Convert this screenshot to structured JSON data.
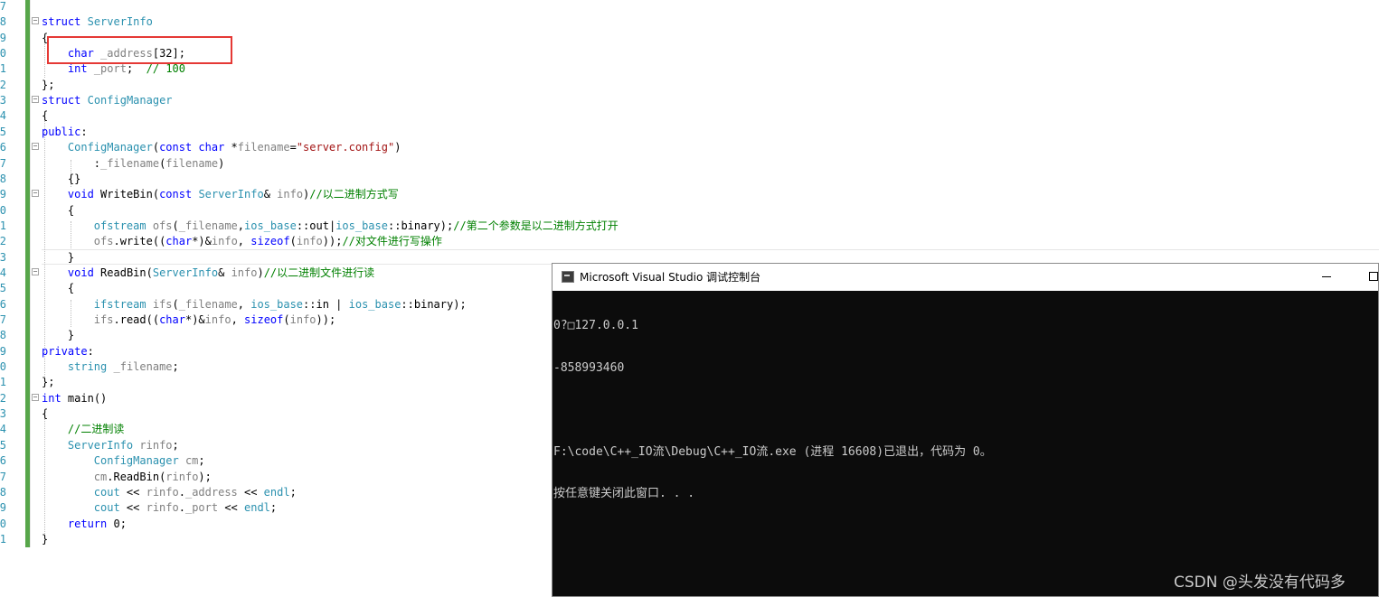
{
  "editor": {
    "lines": [
      {
        "no": "7",
        "text": ""
      },
      {
        "no": "8",
        "text": "struct ServerInfo"
      },
      {
        "no": "9",
        "text": "{"
      },
      {
        "no": "0",
        "text": "    char _address[32];"
      },
      {
        "no": "1",
        "text": "    int _port;  // 100"
      },
      {
        "no": "2",
        "text": "};"
      },
      {
        "no": "3",
        "text": "struct ConfigManager"
      },
      {
        "no": "4",
        "text": "{"
      },
      {
        "no": "5",
        "text": "public:"
      },
      {
        "no": "6",
        "text": "    ConfigManager(const char *filename=\"server.config\")"
      },
      {
        "no": "7",
        "text": "        :_filename(filename)"
      },
      {
        "no": "8",
        "text": "    {}"
      },
      {
        "no": "9",
        "text": "    void WriteBin(const ServerInfo& info)//以二进制方式写"
      },
      {
        "no": "0",
        "text": "    {"
      },
      {
        "no": "1",
        "text": "        ofstream ofs(_filename,ios_base::out|ios_base::binary);//第二个参数是以二进制方式打开"
      },
      {
        "no": "2",
        "text": "        ofs.write((char*)&info, sizeof(info));//对文件进行写操作"
      },
      {
        "no": "3",
        "text": "    }"
      },
      {
        "no": "4",
        "text": "    void ReadBin(ServerInfo& info)//以二进制文件进行读"
      },
      {
        "no": "5",
        "text": "    {"
      },
      {
        "no": "6",
        "text": "        ifstream ifs(_filename, ios_base::in | ios_base::binary);"
      },
      {
        "no": "7",
        "text": "        ifs.read((char*)&info, sizeof(info));"
      },
      {
        "no": "8",
        "text": "    }"
      },
      {
        "no": "9",
        "text": "private:"
      },
      {
        "no": "0",
        "text": "    string _filename;"
      },
      {
        "no": "1",
        "text": "};"
      },
      {
        "no": "2",
        "text": "int main()"
      },
      {
        "no": "3",
        "text": "{"
      },
      {
        "no": "4",
        "text": "    //二进制读"
      },
      {
        "no": "5",
        "text": "    ServerInfo rinfo;"
      },
      {
        "no": "6",
        "text": "        ConfigManager cm;"
      },
      {
        "no": "7",
        "text": "        cm.ReadBin(rinfo);"
      },
      {
        "no": "8",
        "text": "        cout << rinfo._address << endl;"
      },
      {
        "no": "9",
        "text": "        cout << rinfo._port << endl;"
      },
      {
        "no": "0",
        "text": "    return 0;"
      },
      {
        "no": "1",
        "text": "}"
      }
    ]
  },
  "console": {
    "title": "Microsoft Visual Studio 调试控制台",
    "icon": "console-app-icon",
    "output": [
      "0?□127.0.0.1",
      "-858993460",
      "",
      "F:\\code\\C++_IO流\\Debug\\C++_IO流.exe (进程 16608)已退出，代码为 0。",
      "按任意键关闭此窗口. . ."
    ]
  },
  "watermark": "CSDN @头发没有代码多",
  "colors": {
    "keyword": "#0000ff",
    "type": "#2b91af",
    "comment": "#008000",
    "string": "#a31515",
    "change_bar": "#57a64a",
    "highlight_box": "#e53935",
    "console_bg": "#0c0c0c",
    "console_text": "#cccccc"
  }
}
